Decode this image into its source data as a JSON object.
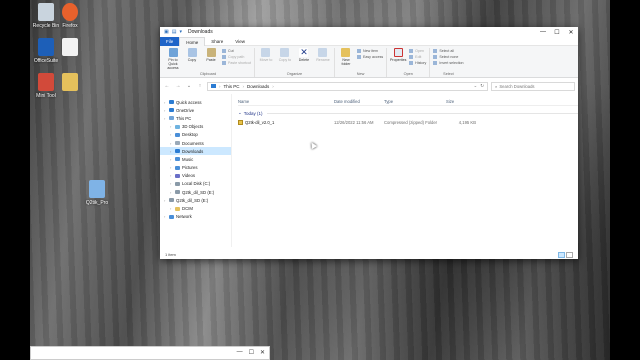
{
  "desktop_icons": [
    {
      "label": "Recycle Bin",
      "icon": "recycle-bin-icon",
      "color": "#c9d4de"
    },
    {
      "label": "Firefox",
      "icon": "firefox-icon",
      "color": "#e8612c"
    },
    {
      "label": "OfficeSuite",
      "icon": "officesuite-icon",
      "color": "#1d5fb8"
    },
    {
      "label": "",
      "icon": "document-icon",
      "color": "#f2f2f2"
    },
    {
      "label": "Mini Tool",
      "icon": "minitool-icon",
      "color": "#d24a3a"
    },
    {
      "label": "",
      "icon": "folder-icon",
      "color": "#e5c15c"
    },
    {
      "label": "Q2tik_Pro",
      "icon": "app-icon",
      "color": "#7fb3e6"
    }
  ],
  "window": {
    "title": "Downloads",
    "controls": {
      "minimize": "—",
      "maximize": "☐",
      "close": "✕"
    },
    "ribbon_tabs": [
      "File",
      "Home",
      "Share",
      "View"
    ],
    "ribbon_groups": {
      "clipboard": {
        "name": "Clipboard",
        "pin": "Pin to Quick access",
        "copy": "Copy",
        "paste": "Paste",
        "cut": "Cut",
        "copy_path": "Copy path",
        "paste_shortcut": "Paste shortcut"
      },
      "organize": {
        "name": "Organize",
        "move_to": "Move to",
        "copy_to": "Copy to",
        "delete": "Delete",
        "rename": "Rename"
      },
      "new": {
        "name": "New",
        "new_folder": "New folder",
        "new_item": "New item",
        "easy_access": "Easy access"
      },
      "open": {
        "name": "Open",
        "properties": "Properties",
        "open": "Open",
        "edit": "Edit",
        "history": "History"
      },
      "select": {
        "name": "Select",
        "select_all": "Select all",
        "select_none": "Select none",
        "invert": "Invert selection"
      }
    },
    "address": {
      "crumbs": [
        "This PC",
        "Downloads"
      ],
      "search_placeholder": "Search Downloads"
    },
    "nav_items": [
      {
        "label": "Quick access",
        "icon": "star-icon",
        "color": "#2b7cd3",
        "indent": 0
      },
      {
        "label": "OneDrive",
        "icon": "cloud-icon",
        "color": "#2b7cd3",
        "indent": 0
      },
      {
        "label": "This PC",
        "icon": "computer-icon",
        "color": "#6fa3d8",
        "indent": 0
      },
      {
        "label": "3D Objects",
        "icon": "cube-icon",
        "color": "#6fb3e0",
        "indent": 1
      },
      {
        "label": "Desktop",
        "icon": "desktop-icon",
        "color": "#4a8fd8",
        "indent": 1
      },
      {
        "label": "Documents",
        "icon": "documents-icon",
        "color": "#9aa9b8",
        "indent": 1
      },
      {
        "label": "Downloads",
        "icon": "download-icon",
        "color": "#2b7cd3",
        "indent": 1,
        "selected": true
      },
      {
        "label": "Music",
        "icon": "music-icon",
        "color": "#4a8fd8",
        "indent": 1
      },
      {
        "label": "Pictures",
        "icon": "pictures-icon",
        "color": "#4a8fd8",
        "indent": 1
      },
      {
        "label": "Videos",
        "icon": "videos-icon",
        "color": "#6a6fc8",
        "indent": 1
      },
      {
        "label": "Local Disk (C:)",
        "icon": "disk-icon",
        "color": "#8a9aa8",
        "indent": 1
      },
      {
        "label": "Q2tk_dil_SD (E:)",
        "icon": "drive-icon",
        "color": "#8a9aa8",
        "indent": 1
      },
      {
        "label": "Q2tk_dil_SD (E:)",
        "icon": "drive-icon",
        "color": "#8a9aa8",
        "indent": 0
      },
      {
        "label": "DCIM",
        "icon": "folder-icon",
        "color": "#e5c15c",
        "indent": 1
      },
      {
        "label": "Network",
        "icon": "network-icon",
        "color": "#4a8fd8",
        "indent": 0
      }
    ],
    "columns": [
      "Name",
      "Date modified",
      "Type",
      "Size"
    ],
    "group_header": "Today (1)",
    "files": [
      {
        "name": "Q2tk-dil_v2.0_1",
        "date": "12/26/2022 11:56 AM",
        "type": "Compressed (zipped) Folder",
        "size": "4,195 KB"
      }
    ],
    "status": "1 item"
  }
}
